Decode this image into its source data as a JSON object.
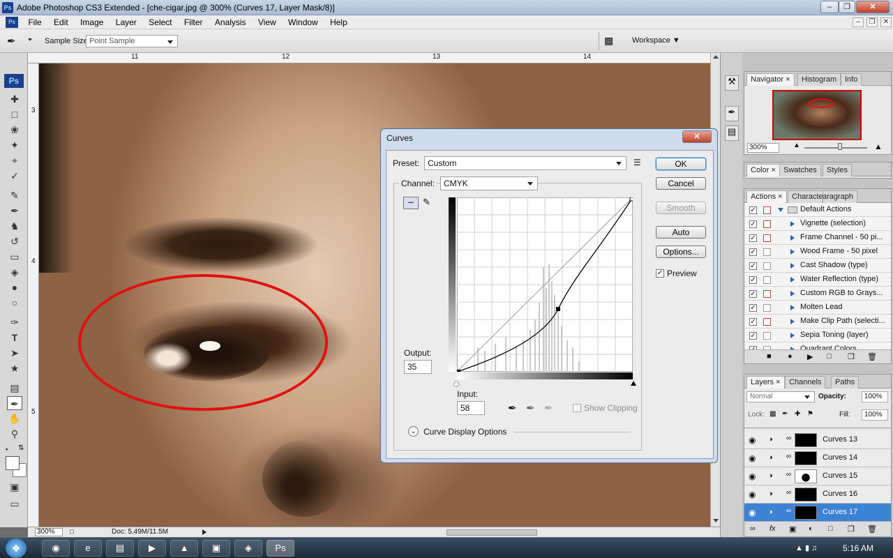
{
  "window": {
    "title": "Adobe Photoshop CS3 Extended - [che-cigar.jpg @ 300% (Curves 17, Layer Mask/8)]",
    "app_icon": "Ps"
  },
  "menu": [
    "File",
    "Edit",
    "Image",
    "Layer",
    "Select",
    "Filter",
    "Analysis",
    "View",
    "Window",
    "Help"
  ],
  "options": {
    "sample_size_label": "Sample Size:",
    "sample_size_value": "Point Sample",
    "workspace_label": "Workspace"
  },
  "ruler": {
    "h": [
      "11",
      "12",
      "13",
      "14"
    ],
    "v": [
      "3",
      "4",
      "5"
    ]
  },
  "status": {
    "zoom": "300%",
    "doc": "Doc: 5.49M/11.5M"
  },
  "navigator": {
    "tabs": [
      "Navigator",
      "Histogram",
      "Info"
    ],
    "zoom": "300%"
  },
  "color_panel": {
    "tabs": [
      "Color",
      "Swatches",
      "Styles"
    ]
  },
  "actions_panel": {
    "tabs": [
      "Actions",
      "Character",
      "Paragraph"
    ],
    "items": [
      {
        "label": "Default Actions",
        "dialog": true
      },
      {
        "label": "Vignette (selection)",
        "dialog": true
      },
      {
        "label": "Frame Channel - 50 pi...",
        "dialog": true
      },
      {
        "label": "Wood Frame - 50 pixel",
        "dialog": false
      },
      {
        "label": "Cast Shadow (type)",
        "dialog": false
      },
      {
        "label": "Water Reflection (type)",
        "dialog": false
      },
      {
        "label": "Custom RGB to Grays...",
        "dialog": true
      },
      {
        "label": "Molten Lead",
        "dialog": false
      },
      {
        "label": "Make Clip Path (selecti...",
        "dialog": true
      },
      {
        "label": "Sepia Toning (layer)",
        "dialog": false
      },
      {
        "label": "Quadrant Colors",
        "dialog": false
      }
    ]
  },
  "layers_panel": {
    "tabs": [
      "Layers",
      "Channels",
      "Paths"
    ],
    "blend_mode": "Normal",
    "opacity_label": "Opacity:",
    "opacity": "100%",
    "lock_label": "Lock:",
    "fill_label": "Fill:",
    "fill": "100%",
    "layers": [
      "Curves 13",
      "Curves 14",
      "Curves 15",
      "Curves 16",
      "Curves 17"
    ],
    "selected": "Curves 17"
  },
  "curves": {
    "title": "Curves",
    "preset_label": "Preset:",
    "preset_value": "Custom",
    "channel_label": "Channel:",
    "channel_value": "CMYK",
    "output_label": "Output:",
    "output_value": "35",
    "input_label": "Input:",
    "input_value": "58",
    "show_clipping": "Show Clipping",
    "display_options": "Curve Display Options",
    "buttons": {
      "ok": "OK",
      "cancel": "Cancel",
      "smooth": "Smooth",
      "auto": "Auto",
      "options": "Options..."
    },
    "preview_label": "Preview"
  },
  "taskbar": {
    "time": "5:16 AM"
  }
}
